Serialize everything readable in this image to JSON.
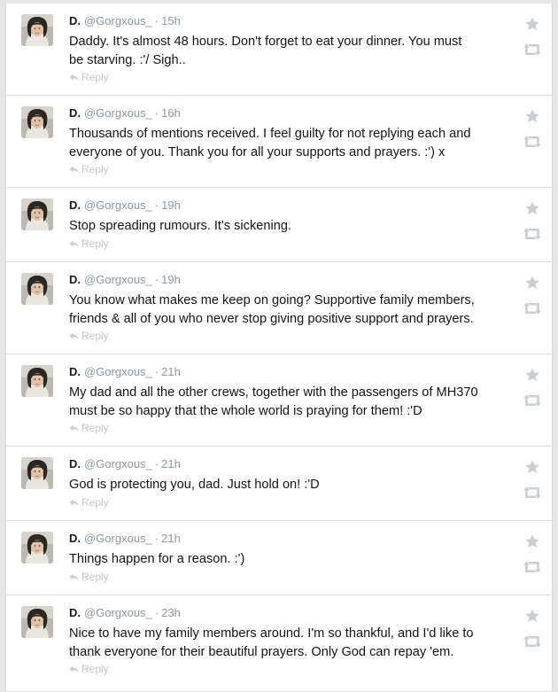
{
  "profile": {
    "name": "D.",
    "handle": "@Gorgxous_"
  },
  "reply_label": "Reply",
  "separator": "·",
  "colors": {
    "meta_gray": "#8899a6",
    "action_gray": "#c8ced3",
    "text": "#141414"
  },
  "icons": {
    "favorite": "star-icon",
    "retweet": "retweet-icon",
    "reply": "reply-arrow-icon"
  },
  "tweets": [
    {
      "time": "15h",
      "text": "Daddy. It's almost 48 hours. Don't forget to eat your dinner. You must\nbe starving. :'/ Sigh.."
    },
    {
      "time": "16h",
      "text": "Thousands of mentions received. I feel guilty for not replying each and\neveryone of you. Thank you for all your supports and prayers. :') x"
    },
    {
      "time": "19h",
      "text": "Stop spreading rumours. It's sickening."
    },
    {
      "time": "19h",
      "text": "You know what makes me keep on going? Supportive family members,\nfriends & all of you who never stop giving positive support and prayers."
    },
    {
      "time": "21h",
      "text": "My dad and all the other crews, together with the passengers of MH370\nmust be so happy that the whole world is praying for them! :'D"
    },
    {
      "time": "21h",
      "text": "God is protecting you, dad. Just hold on! :'D"
    },
    {
      "time": "21h",
      "text": "Things happen for a reason. :')"
    },
    {
      "time": "23h",
      "text": "Nice to have my family members around. I'm so thankful, and I'd like to\nthank everyone for their beautiful prayers. Only God can repay 'em."
    }
  ]
}
